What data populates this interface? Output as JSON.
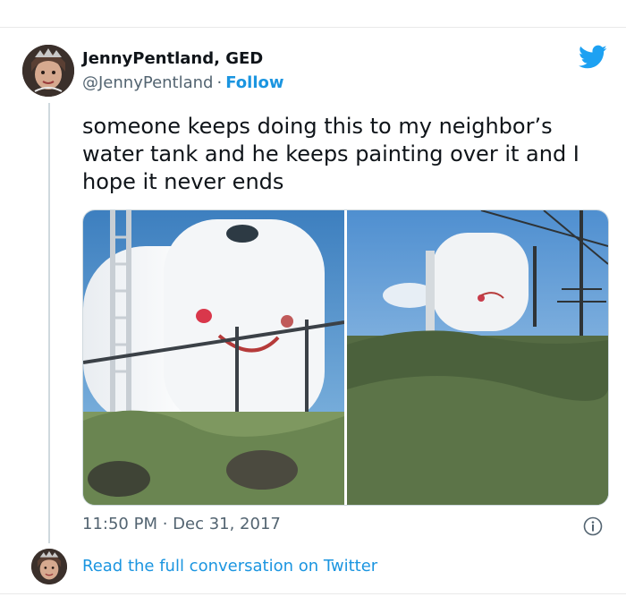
{
  "author": {
    "display_name": "JennyPentland, GED",
    "handle": "@JennyPentland",
    "separator": "·",
    "follow_label": "Follow"
  },
  "tweet": {
    "text": "someone keeps doing this to my neighbor’s water tank and he keeps painting over it and I hope it never ends",
    "timestamp": "11:50 PM · Dec 31, 2017"
  },
  "footer": {
    "read_more_label": "Read the full conversation on Twitter"
  },
  "icons": {
    "brand": "twitter-bird-icon",
    "info": "info-icon"
  },
  "colors": {
    "link": "#1b95e0",
    "twitter_blue": "#1da1f2",
    "secondary_text": "#536471"
  }
}
